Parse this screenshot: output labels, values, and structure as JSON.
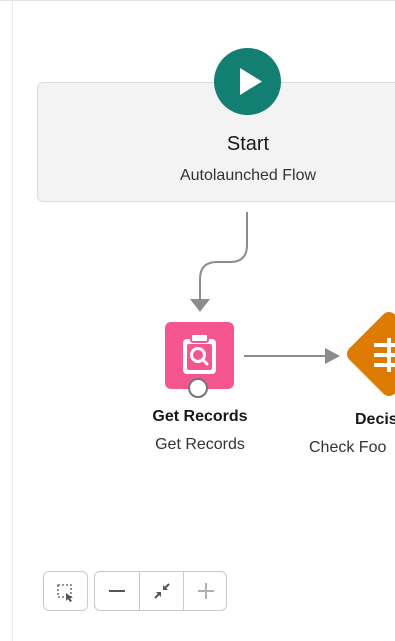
{
  "start": {
    "title": "Start",
    "subtitle": "Autolaunched Flow",
    "icon": "play-icon",
    "color": "#137f72"
  },
  "get_records": {
    "title": "Get Records",
    "subtitle": "Get Records",
    "icon": "clipboard-search-icon",
    "color": "#f6568f"
  },
  "decision": {
    "title": "Decis",
    "subtitle": "Check Foo",
    "icon": "decision-icon",
    "color": "#dd7a01"
  },
  "controls": {
    "select_icon": "select-elements-icon",
    "zoom_out_icon": "minus-icon",
    "fit_icon": "fit-view-icon",
    "zoom_in_icon": "plus-icon"
  },
  "connector_color": "#8c8c8c"
}
